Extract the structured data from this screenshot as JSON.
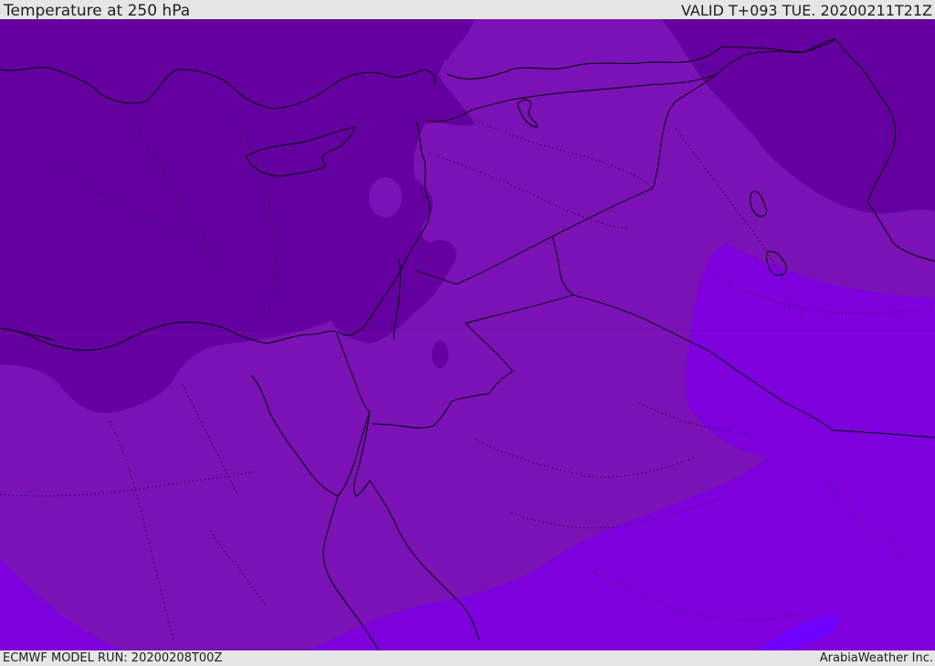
{
  "header": {
    "title": "Temperature at 250 hPa",
    "valid_time": "VALID T+093 TUE. 20200211T21Z"
  },
  "footer": {
    "model_run": "ECMWF MODEL RUN: 20200208T00Z",
    "credit": "ArabiaWeather Inc."
  },
  "map": {
    "region": "Eastern Mediterranean and Middle East",
    "colors": {
      "coldest": "#6500a0",
      "cold": "#7a12b5",
      "cool": "#7d00dd",
      "core": "#7000ff",
      "coastline": "#000000"
    }
  }
}
